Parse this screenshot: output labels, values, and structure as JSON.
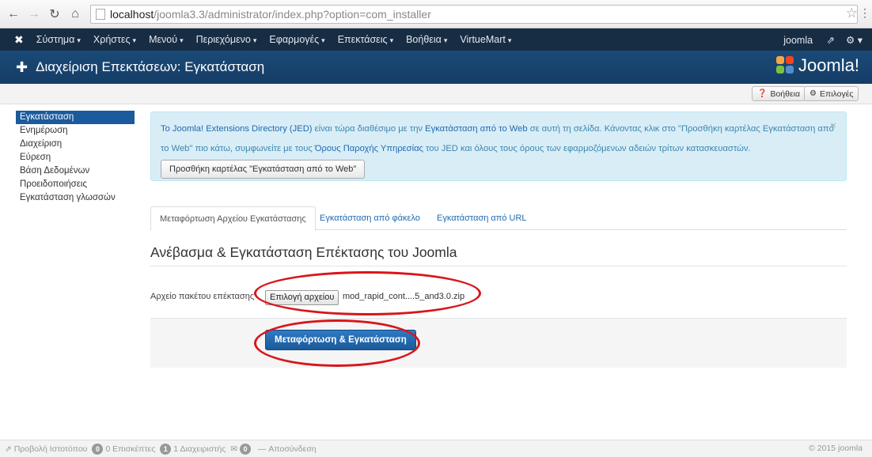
{
  "browser": {
    "url_host": "localhost",
    "url_path": "/joomla3.3/administrator/index.php?option=com_installer"
  },
  "navbar": {
    "items": [
      "Σύστημα",
      "Χρήστες",
      "Μενού",
      "Περιεχόμενο",
      "Εφαρμογές",
      "Επεκτάσεις",
      "Βοήθεια",
      "VirtueMart"
    ],
    "user": "joomla"
  },
  "header": {
    "title": "Διαχείριση Επεκτάσεων: Εγκατάσταση",
    "logo_text": "Joomla!"
  },
  "toolbar": {
    "help_label": "Βοήθεια",
    "options_label": "Επιλογές"
  },
  "sidebar": {
    "items": [
      {
        "label": "Εγκατάσταση",
        "active": true
      },
      {
        "label": "Ενημέρωση",
        "active": false
      },
      {
        "label": "Διαχείριση",
        "active": false
      },
      {
        "label": "Εύρεση",
        "active": false
      },
      {
        "label": "Βάση Δεδομένων",
        "active": false
      },
      {
        "label": "Προειδοποιήσεις",
        "active": false
      },
      {
        "label": "Εγκατάσταση γλωσσών",
        "active": false
      }
    ]
  },
  "alert": {
    "link1": "Το Joomla! Extensions Directory (JED)",
    "text1": " είναι τώρα διαθέσιμο με την ",
    "link2": "Εγκατάσταση από το Web",
    "text2": " σε αυτή τη σελίδα.  Κάνοντας κλικ στο \"Προσθήκη καρτέλας Εγκατάσταση από το Web\" πιο κάτω, συμφωνείτε με τους ",
    "link3": "Όρους Παροχής Υπηρεσίας",
    "text3": " του JED και όλους τους όρους των εφαρμοζόμενων αδειών τρίτων κατασκευαστών.",
    "button": "Προσθήκη καρτέλας \"Εγκατάσταση από το Web\"",
    "close": "×"
  },
  "tabs": [
    {
      "label": "Μεταφόρτωση Αρχείου Εγκατάστασης",
      "active": true
    },
    {
      "label": "Εγκατάσταση από φάκελο",
      "active": false
    },
    {
      "label": "Εγκατάσταση από URL",
      "active": false
    }
  ],
  "upload": {
    "title": "Ανέβασμα & Εγκατάσταση Επέκτασης του Joomla",
    "field_label": "Αρχείο πακέτου επέκτασης",
    "choose_file": "Επιλογή αρχείου",
    "file_name": "mod_rapid_cont....5_and3.0.zip",
    "submit": "Μεταφόρτωση & Εγκατάσταση"
  },
  "statusbar": {
    "view_site": "Προβολή Ιστοτόπου",
    "visitors_count": "0",
    "visitors_label": "0 Επισκέπτες",
    "admins_count": "1",
    "admins_label": "1 Διαχειριστής",
    "messages_count": "0",
    "logout": "Αποσύνδεση",
    "copyright": "© 2015 joomla"
  },
  "colors": {
    "navbar": "#172d44",
    "header": "#1a4a78",
    "primary": "#1b5a9c",
    "annotation": "#d8161b"
  }
}
